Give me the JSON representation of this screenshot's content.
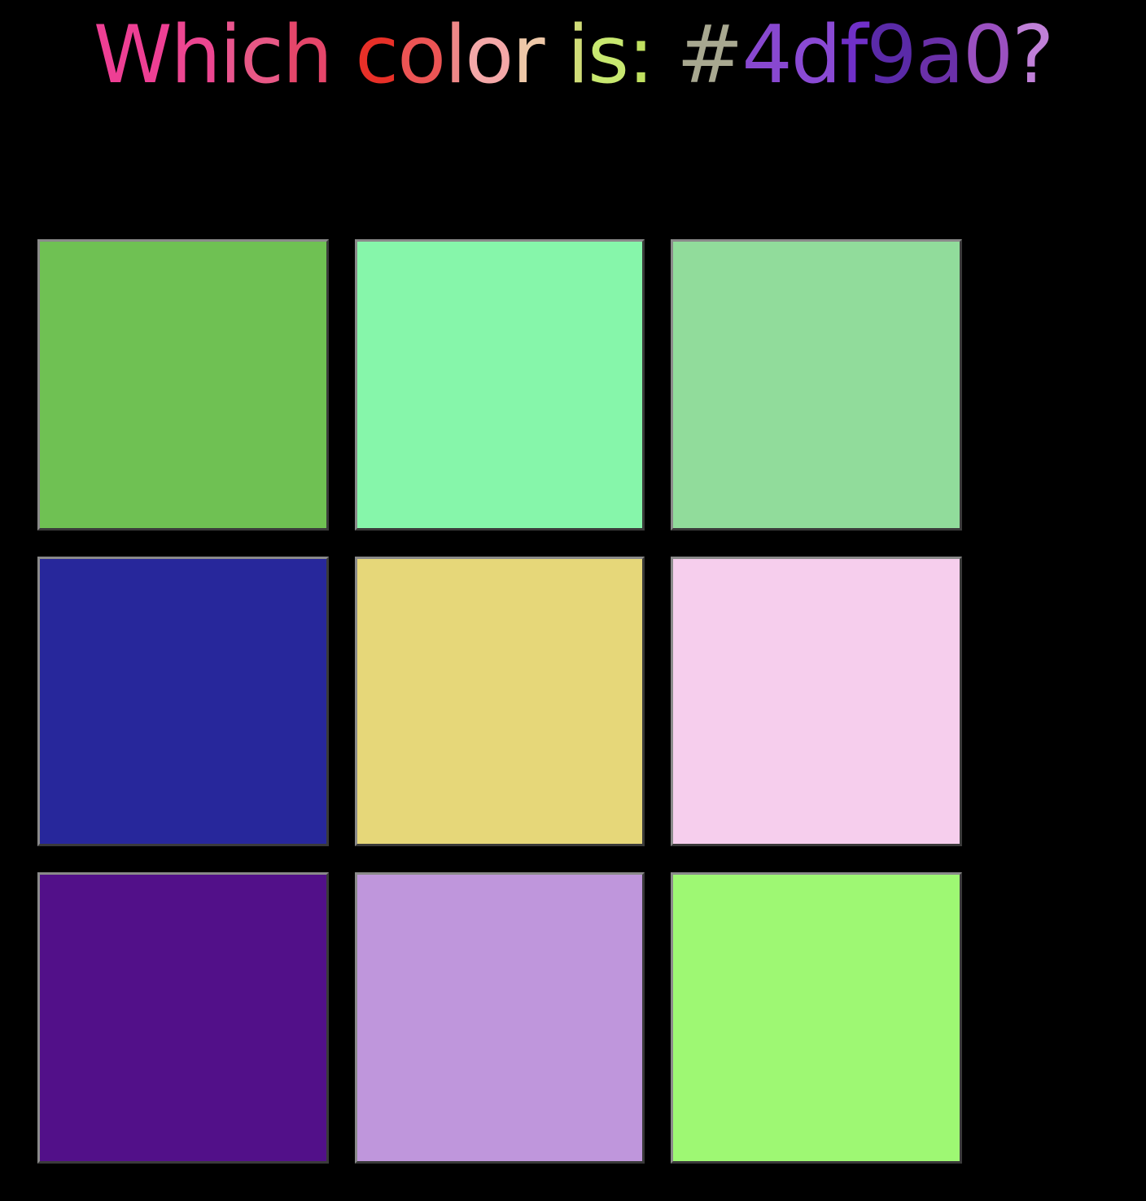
{
  "prompt": {
    "chars": [
      {
        "ch": "W",
        "color": "#ee3f94"
      },
      {
        "ch": "h",
        "color": "#ed4691"
      },
      {
        "ch": "i",
        "color": "#ea558e"
      },
      {
        "ch": "c",
        "color": "#e85886"
      },
      {
        "ch": "h",
        "color": "#e5466a"
      },
      {
        "ch": " ",
        "color": "#000000"
      },
      {
        "ch": "c",
        "color": "#e83028"
      },
      {
        "ch": "o",
        "color": "#ec5454"
      },
      {
        "ch": "l",
        "color": "#f08888"
      },
      {
        "ch": "o",
        "color": "#f4a8a8"
      },
      {
        "ch": "r",
        "color": "#eec8a8"
      },
      {
        "ch": " ",
        "color": "#000000"
      },
      {
        "ch": "i",
        "color": "#d0dc78"
      },
      {
        "ch": "s",
        "color": "#c8e870"
      },
      {
        "ch": ":",
        "color": "#c0e060"
      },
      {
        "ch": " ",
        "color": "#000000"
      },
      {
        "ch": "#",
        "color": "#a8a890"
      },
      {
        "ch": "4",
        "color": "#8848d0"
      },
      {
        "ch": "d",
        "color": "#8a4ad4"
      },
      {
        "ch": "f",
        "color": "#7030c8"
      },
      {
        "ch": "9",
        "color": "#5a2aa8"
      },
      {
        "ch": "a",
        "color": "#6a30a8"
      },
      {
        "ch": "0",
        "color": "#9a50c0"
      },
      {
        "ch": "?",
        "color": "#c080d8"
      }
    ]
  },
  "tiles": [
    {
      "color": "#6fc153"
    },
    {
      "color": "#86f6aa"
    },
    {
      "color": "#91dc9b"
    },
    {
      "color": "#27279b"
    },
    {
      "color": "#e6d779"
    },
    {
      "color": "#f6ceed"
    },
    {
      "color": "#521089"
    },
    {
      "color": "#bf96dc"
    },
    {
      "color": "#9ef873"
    }
  ]
}
